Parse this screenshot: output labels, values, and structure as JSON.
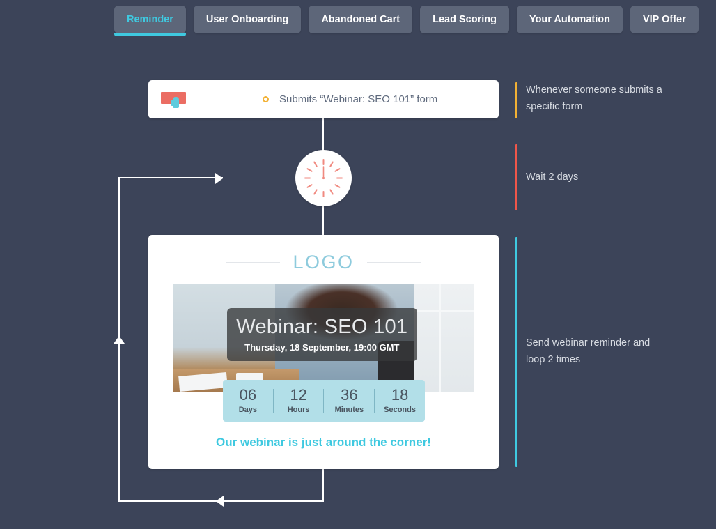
{
  "theme": {
    "background": "#3c4459",
    "tab_bg": "#5d6679",
    "accent_cyan": "#3fc9e0",
    "accent_yellow": "#f2b134",
    "accent_red": "#f0564a",
    "connector": "#ffffff"
  },
  "tabs": [
    {
      "label": "Reminder",
      "active": true
    },
    {
      "label": "User Onboarding",
      "active": false
    },
    {
      "label": "Abandoned Cart",
      "active": false
    },
    {
      "label": "Lead Scoring",
      "active": false
    },
    {
      "label": "Your Automation",
      "active": false
    },
    {
      "label": "VIP Offer",
      "active": false
    }
  ],
  "trigger": {
    "icon": "form-click-icon",
    "status_dot": "yellow-circle-icon",
    "text": "Submits “Webinar: SEO 101” form"
  },
  "wait": {
    "icon": "clock-icon"
  },
  "email": {
    "logo": "LOGO",
    "hero_title": "Webinar: SEO 101",
    "hero_subtitle": "Thursday, 18 September, 19:00 GMT",
    "countdown": [
      {
        "value": "06",
        "label": "Days"
      },
      {
        "value": "12",
        "label": "Hours"
      },
      {
        "value": "36",
        "label": "Minutes"
      },
      {
        "value": "18",
        "label": "Seconds"
      }
    ],
    "tagline": "Our webinar is just around the corner!"
  },
  "annotations": [
    {
      "text": "Whenever someone submits a\nspecific form",
      "color": "#f2b134"
    },
    {
      "text": "Wait 2 days",
      "color": "#f0564a"
    },
    {
      "text": "Send webinar reminder and\nloop 2 times",
      "color": "#3fc9e0"
    }
  ]
}
